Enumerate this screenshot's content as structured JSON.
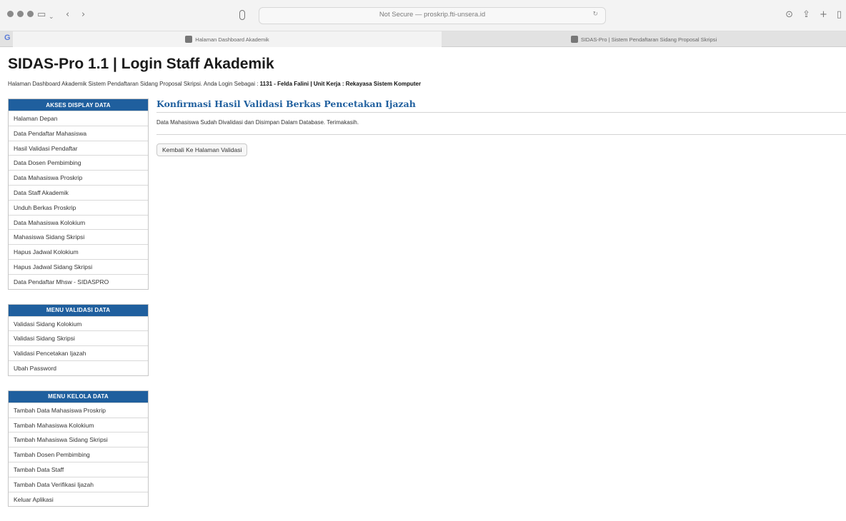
{
  "browser": {
    "address": "Not Secure — proskrip.fti-unsera.id",
    "tabs": [
      {
        "label": "Halaman Dashboard Akademik",
        "active": true
      },
      {
        "label": "SIDAS-Pro | Sistem Pendaftaran Sidang Proposal Skripsi",
        "active": false
      }
    ],
    "colors": {
      "chrome": "#f3f3f3",
      "tabbar": "#e2e2e2"
    }
  },
  "page": {
    "title": "SIDAS-Pro 1.1 | Login Staff Akademik",
    "subtitle_text": "Halaman Dashboard Akademik Sistem Pendaftaran Sidang Proposal Skripsi. Anda Login Sebagai : ",
    "subtitle_user": "1131 - Felda Falini | Unit Kerja : Rekayasa Sistem Komputer",
    "accent_color": "#1f5f9e"
  },
  "sidebar": {
    "groups": [
      {
        "title": "AKSES DISPLAY DATA",
        "items": [
          "Halaman Depan",
          "Data Pendaftar Mahasiswa",
          "Hasil Validasi Pendaftar",
          "Data Dosen Pembimbing",
          "Data Mahasiswa Proskrip",
          "Data Staff Akademik",
          "Unduh Berkas Proskrip",
          "Data Mahasiswa Kolokium",
          "Mahasiswa Sidang Skripsi",
          "Hapus Jadwal Kolokium",
          "Hapus Jadwal Sidang Skripsi",
          "Data Pendaftar Mhsw - SIDASPRO"
        ]
      },
      {
        "title": "MENU VALIDASI DATA",
        "items": [
          "Validasi Sidang Kolokium",
          "Validasi Sidang Skripsi",
          "Validasi Pencetakan Ijazah",
          "Ubah Password"
        ]
      },
      {
        "title": "MENU KELOLA DATA",
        "items": [
          "Tambah Data Mahasiswa Proskrip",
          "Tambah Mahasiswa Kolokium",
          "Tambah Mahasiswa Sidang Skripsi",
          "Tambah Dosen Pembimbing",
          "Tambah Data Staff",
          "Tambah Data Verifikasi Ijazah",
          "Keluar Aplikasi"
        ]
      }
    ]
  },
  "main": {
    "title": "Konfirmasi Hasil Validasi Berkas Pencetakan Ijazah",
    "message": "Data Mahasiswa Sudah Divalidasi dan Disimpan Dalam Database. Terimakasih.",
    "back_button": "Kembali Ke Halaman Validasi"
  }
}
